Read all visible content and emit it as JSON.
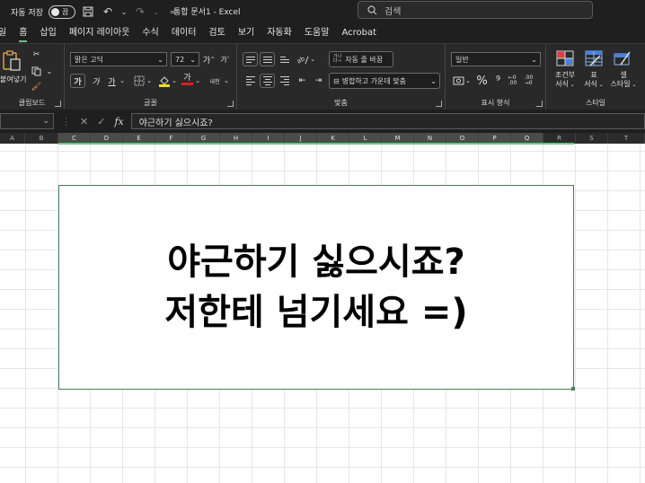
{
  "titlebar": {
    "autosave_label": "자동 저장",
    "toggle_state": "끔",
    "document_title": "통합 문서1  -  Excel",
    "search_placeholder": "검색"
  },
  "menu": {
    "tabs": [
      {
        "label": "일"
      },
      {
        "label": "홈",
        "active": true
      },
      {
        "label": "삽입"
      },
      {
        "label": "페이지 레이아웃"
      },
      {
        "label": "수식"
      },
      {
        "label": "데이터"
      },
      {
        "label": "검토"
      },
      {
        "label": "보기"
      },
      {
        "label": "자동화"
      },
      {
        "label": "도움말"
      },
      {
        "label": "Acrobat"
      }
    ]
  },
  "ribbon": {
    "clipboard": {
      "paste_label": "붙여넣기",
      "group_label": "클립보드"
    },
    "font": {
      "font_name": "맑은 고딕",
      "font_size": "72",
      "group_label": "글꼴",
      "bold": "가",
      "italic": "가",
      "underline": "가",
      "font_color_glyph": "가",
      "phonetic": "내천"
    },
    "alignment": {
      "wrap_text": "자동 줄 바꿈",
      "merge_center": "병합하고 가운데 맞춤",
      "group_label": "맞춤"
    },
    "number": {
      "format": "일반",
      "group_label": "표시 형식"
    },
    "styles": {
      "conditional_line1": "조건부",
      "conditional_line2": "서식",
      "table_line1": "표",
      "table_line2": "서식",
      "cell_line1": "셀",
      "cell_line2": "스타일",
      "group_label": "스타일"
    }
  },
  "formula_bar": {
    "formula": "야근하기 싫으시죠?"
  },
  "columns": [
    "A",
    "B",
    "C",
    "D",
    "E",
    "F",
    "G",
    "H",
    "I",
    "J",
    "K",
    "L",
    "M",
    "N",
    "O",
    "P",
    "Q",
    "R",
    "S",
    "T"
  ],
  "textbox": {
    "line1": "야근하기 싫으시죠?",
    "line2": "저한테 넘기세요 =)"
  },
  "colors": {
    "accent": "#6fc28b",
    "chrome": "#1f1f1f",
    "ribbon": "#292929"
  }
}
